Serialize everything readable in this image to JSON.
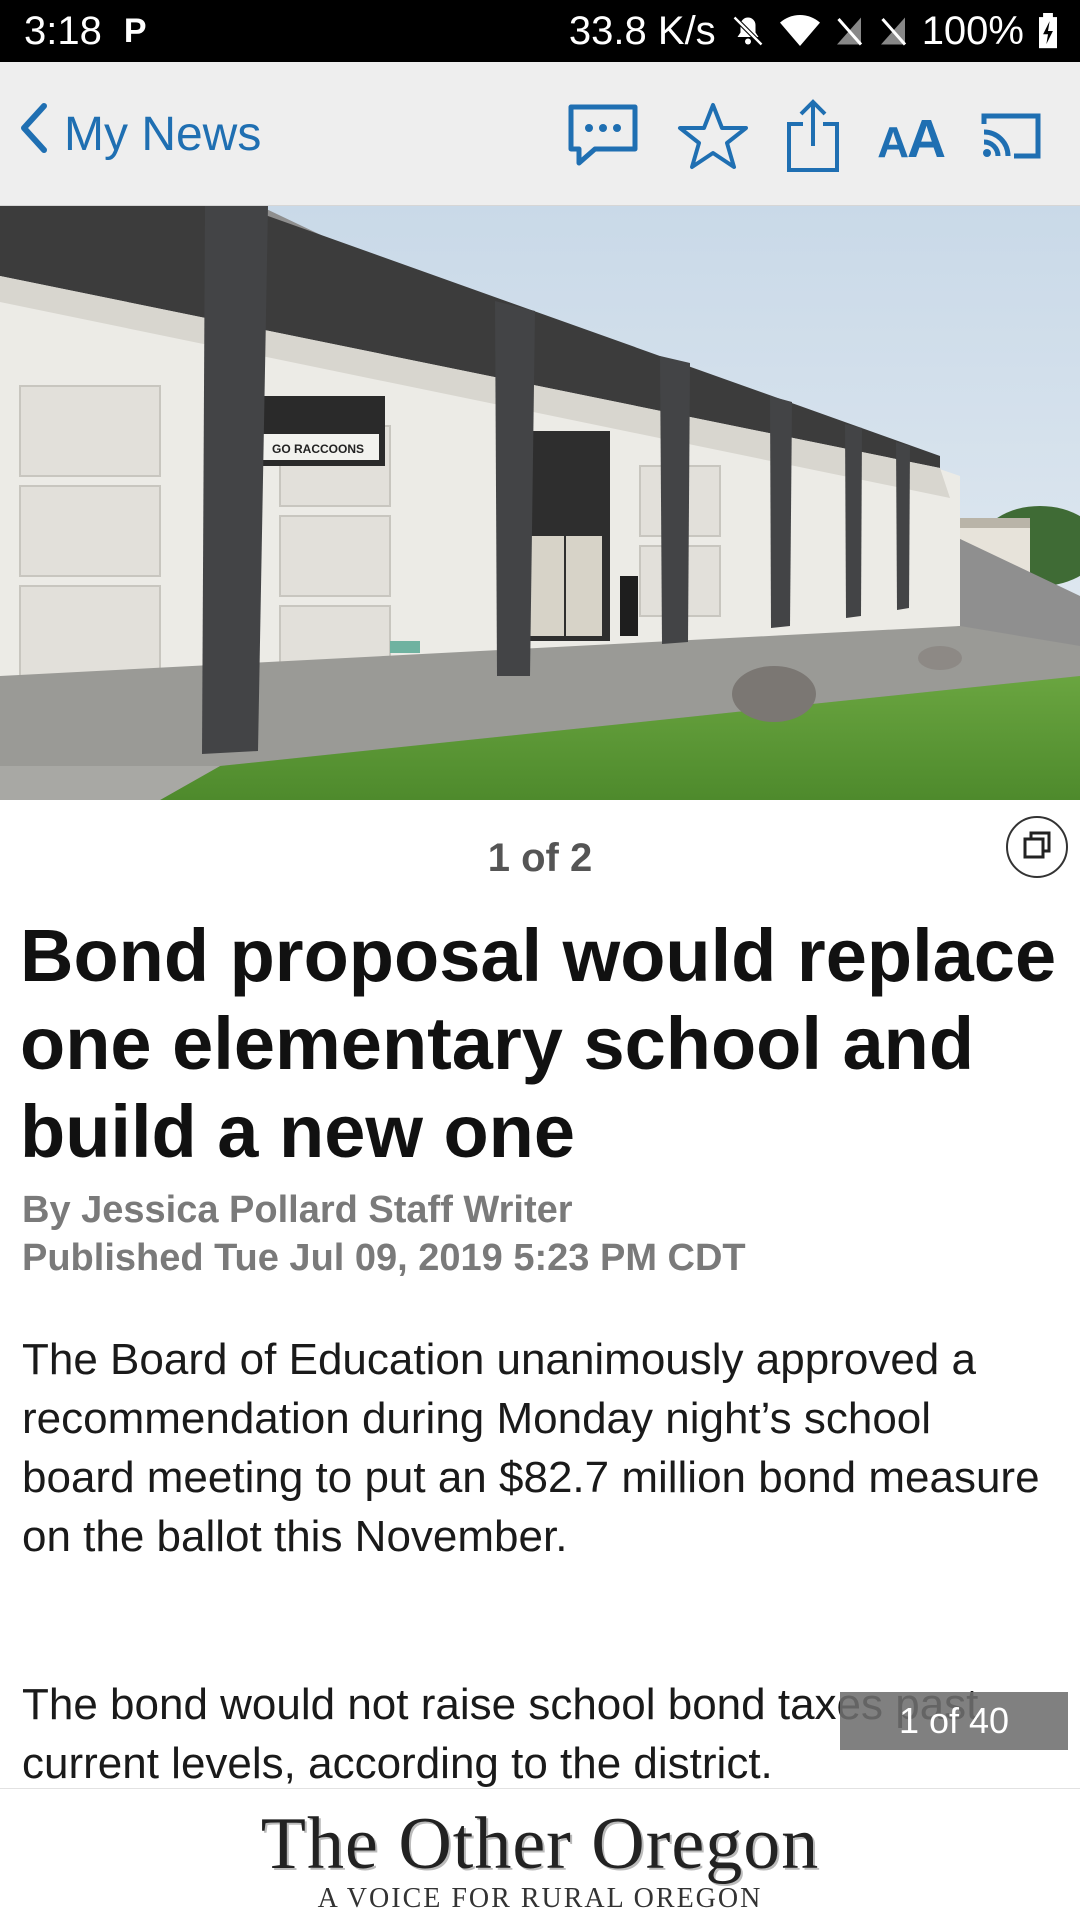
{
  "status_bar": {
    "time": "3:18",
    "app_badge": "P",
    "net_speed": "33.8 K/s",
    "battery": "100%",
    "icons": [
      "mute-icon",
      "wifi-icon",
      "no-sim-icon",
      "no-sim-icon",
      "battery-icon"
    ]
  },
  "nav": {
    "back_label": "My News",
    "actions": [
      "comments-icon",
      "favorite-star-icon",
      "share-icon",
      "text-size-icon",
      "cast-icon"
    ],
    "text_size_label_small": "A",
    "text_size_label_large": "A",
    "accent_color": "#1f6fb2"
  },
  "hero": {
    "counter": "1 of 2",
    "sign_text": "GO RACCOONS"
  },
  "article": {
    "headline": "Bond proposal would replace one elementary school and build a new one",
    "byline": "By Jessica Pollard Staff Writer",
    "published": "Published Tue Jul 09, 2019 5:23 PM CDT",
    "paragraphs": [
      "The Board of Education unanimously approved a recommendation during Monday night’s school board meeting to put an $82.7 million bond measure on the ballot this November.",
      "The bond would not raise school bond taxes past current levels, according to the district."
    ],
    "page_indicator": "1 of 40"
  },
  "footer_ad": {
    "title": "The Other Oregon",
    "subtitle": "A VOICE FOR RURAL OREGON"
  }
}
